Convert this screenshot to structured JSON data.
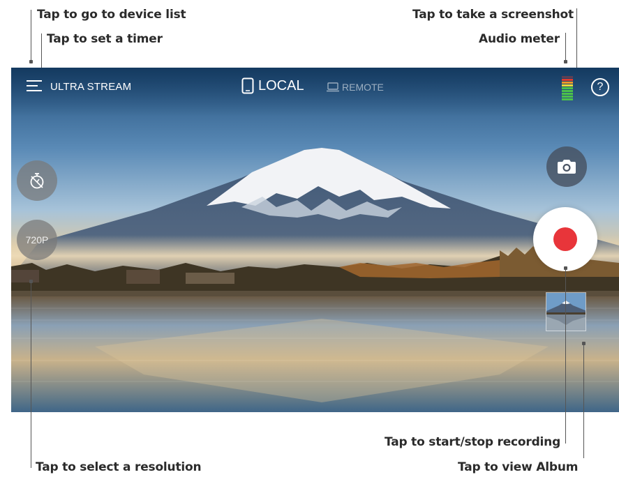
{
  "annotations": {
    "device_list": "Tap to go to device list",
    "timer": "Tap to set a timer",
    "screenshot": "Tap to take a screenshot",
    "audio_meter": "Audio meter",
    "record": "Tap to start/stop recording",
    "resolution": "Tap to select a resolution",
    "album": "Tap to view Album"
  },
  "app": {
    "title": "ULTRA STREAM",
    "tab_local": "LOCAL",
    "tab_remote": "REMOTE",
    "help_glyph": "?"
  },
  "controls": {
    "resolution": "720P",
    "timer_icon": "stopwatch-icon",
    "camera_icon": "camera-icon",
    "record_color": "#e8353a"
  },
  "audio_meter": {
    "level": 0.85,
    "colors": [
      "#e03b2f",
      "#f29a2a",
      "#e8d83a",
      "#4cc24a"
    ]
  }
}
